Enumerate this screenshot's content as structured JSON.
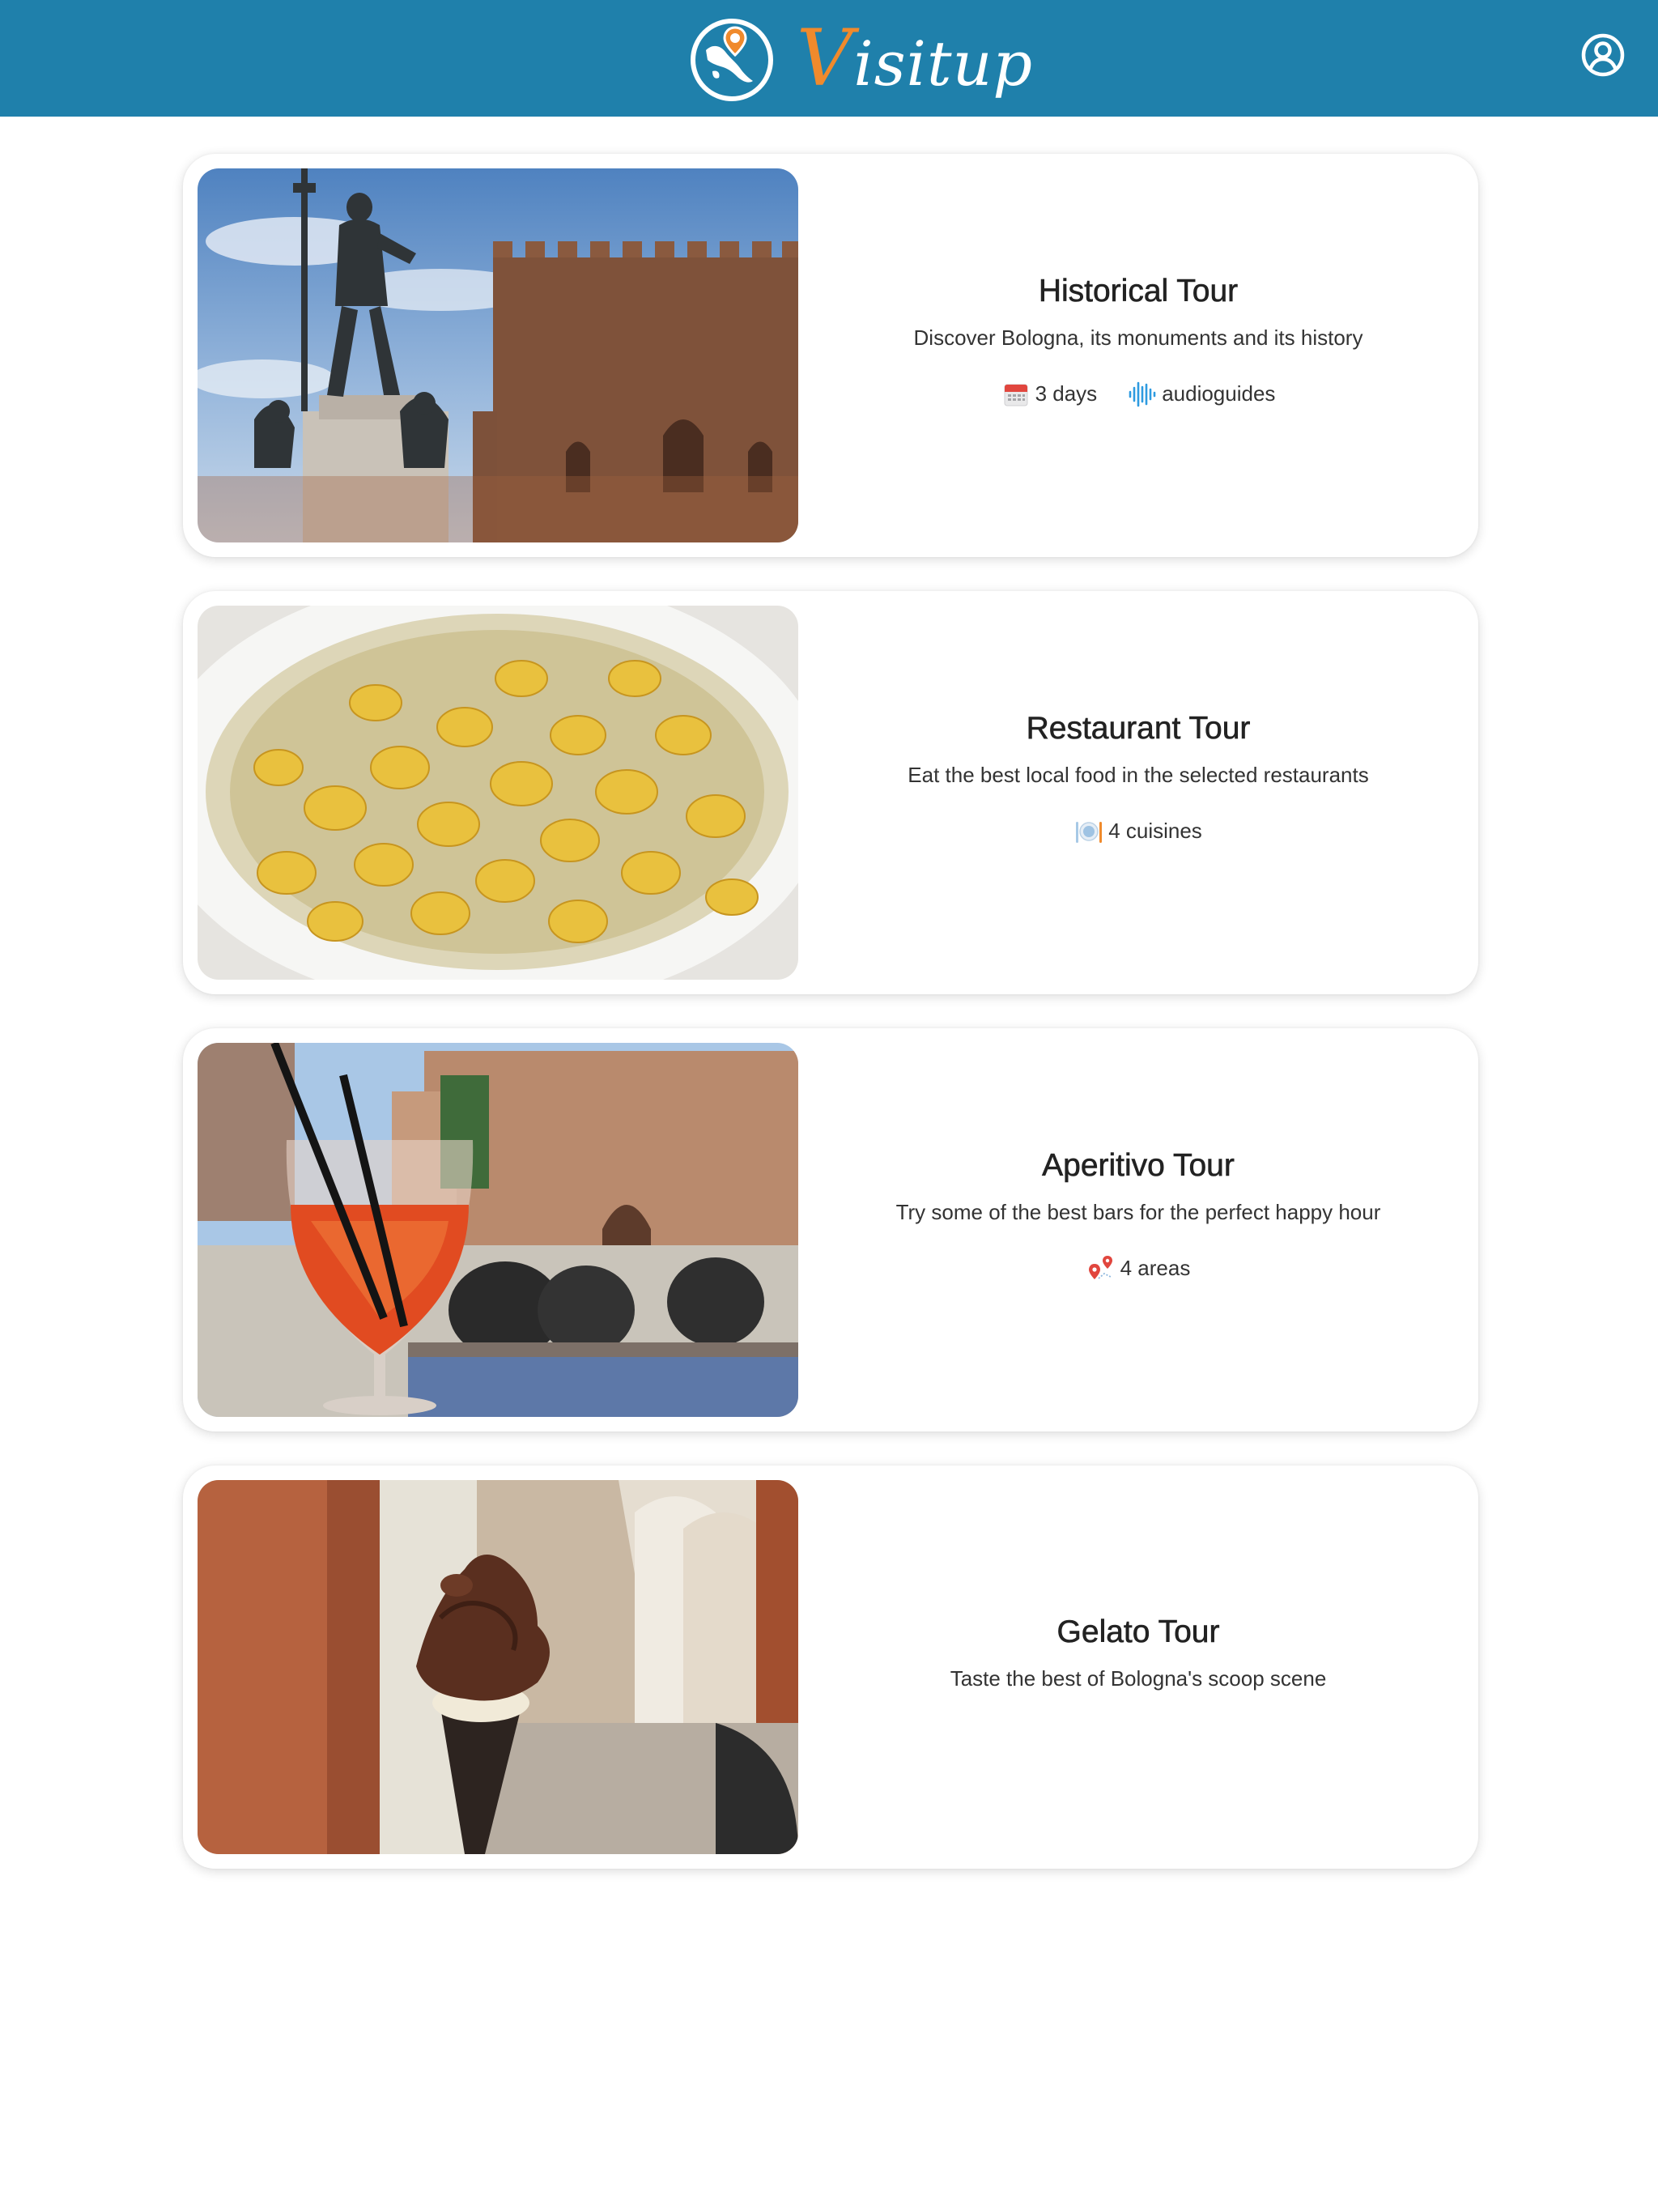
{
  "header": {
    "logo_text_first": "V",
    "logo_text_rest": "isitup",
    "background_color": "#1f80ab",
    "accent_color": "#f08a2c",
    "account_icon": "account-circle-icon"
  },
  "tours": [
    {
      "title": "Historical Tour",
      "description": "Discover Bologna, its monuments and its history",
      "image": "neptune-statue-photo",
      "meta": [
        {
          "icon": "calendar-icon",
          "label": "3 days"
        },
        {
          "icon": "audio-wave-icon",
          "label": "audioguides"
        }
      ]
    },
    {
      "title": "Restaurant Tour",
      "description": "Eat the best local food in the selected restaurants",
      "image": "tortellini-photo",
      "meta": [
        {
          "icon": "plate-cutlery-icon",
          "label": "4 cuisines"
        }
      ]
    },
    {
      "title": "Aperitivo Tour",
      "description": "Try some of the best bars for the perfect happy hour",
      "image": "spritz-photo",
      "meta": [
        {
          "icon": "map-pins-icon",
          "label": "4 areas"
        }
      ]
    },
    {
      "title": "Gelato Tour",
      "description": "Taste the best of Bologna's scoop scene",
      "image": "gelato-photo",
      "meta": []
    }
  ]
}
